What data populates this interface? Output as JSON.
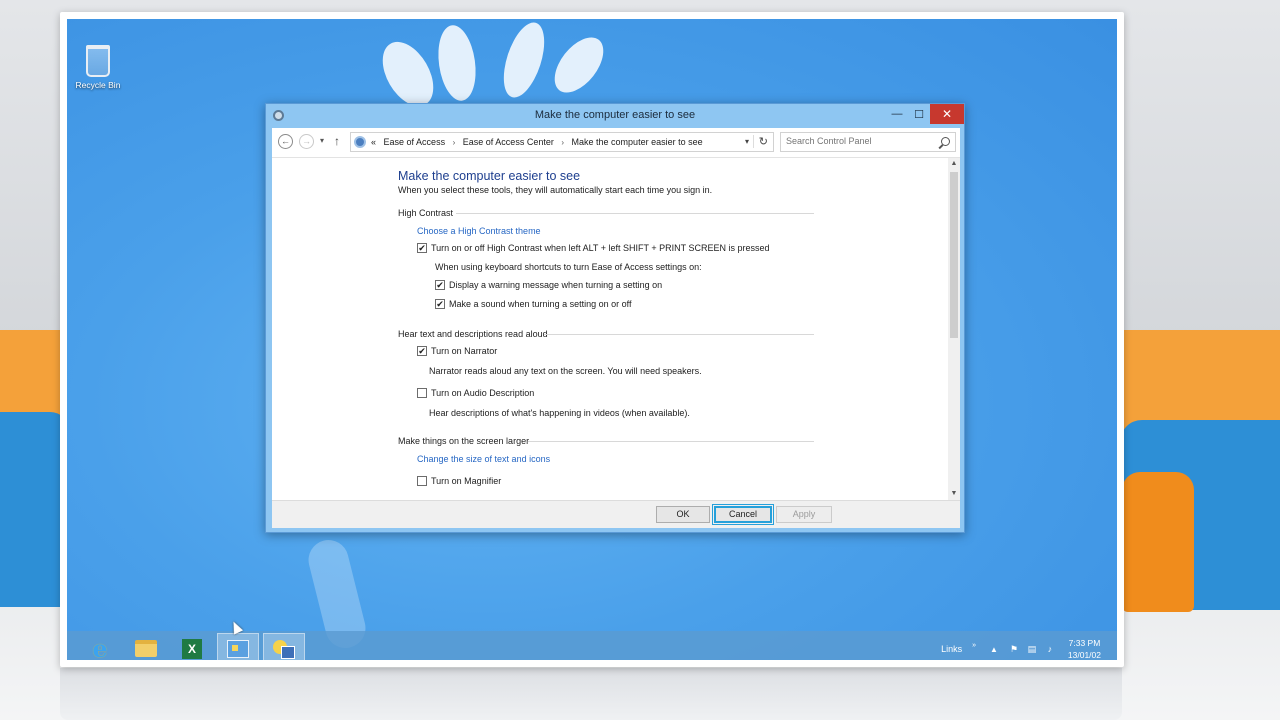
{
  "desktop": {
    "recycle_bin_label": "Recycle Bin"
  },
  "window": {
    "title": "Make the computer easier to see",
    "controls": {
      "minimize": "—",
      "maximize": "☐",
      "close": "✕"
    },
    "nav": {
      "back": "←",
      "forward": "→",
      "recent": "▾",
      "up": "↑"
    },
    "breadcrumb": {
      "overflow": "«",
      "items": [
        "Ease of Access",
        "Ease of Access Center",
        "Make the computer easier to see"
      ],
      "separator": "›"
    },
    "search": {
      "placeholder": "Search Control Panel"
    }
  },
  "content": {
    "page_title": "Make the computer easier to see",
    "page_description": "When you select these tools, they will automatically start each time you sign in.",
    "high_contrast": {
      "heading": "High Contrast",
      "link": "Choose a High Contrast theme",
      "toggle_label": "Turn on or off High Contrast when left ALT + left SHIFT + PRINT SCREEN is pressed",
      "toggle_checked": true,
      "shortcut_note": "When using keyboard shortcuts to turn Ease of Access settings on:",
      "warning_label": "Display a warning message when turning a setting on",
      "warning_checked": true,
      "sound_label": "Make a sound when turning a setting on or off",
      "sound_checked": true
    },
    "narration": {
      "heading": "Hear text and descriptions read aloud",
      "narrator_label": "Turn on Narrator",
      "narrator_checked": true,
      "narrator_desc": "Narrator reads aloud any text on the screen. You will need speakers.",
      "audio_desc_label": "Turn on Audio Description",
      "audio_desc_checked": false,
      "audio_desc_desc": "Hear descriptions of what's happening in videos (when available)."
    },
    "larger": {
      "heading": "Make things on the screen larger",
      "link": "Change the size of text and icons",
      "magnifier_label": "Turn on Magnifier",
      "magnifier_checked": false
    }
  },
  "buttons": {
    "ok": "OK",
    "cancel": "Cancel",
    "apply": "Apply"
  },
  "taskbar": {
    "excel_letter": "X",
    "tray_links": "Links",
    "tray_chevron": "»",
    "tray_show_hidden": "▲",
    "time": "7:33 PM",
    "date": "13/01/02"
  },
  "colors": {
    "link": "#2667c4",
    "title": "#1e3f8f",
    "close_button": "#c7382e",
    "focus": "#26a0da"
  }
}
